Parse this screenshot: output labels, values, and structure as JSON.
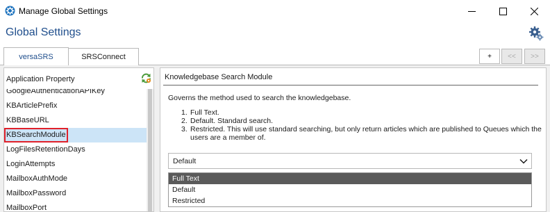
{
  "window": {
    "title": "Manage Global Settings",
    "icon": "app-gear-icon",
    "controls": [
      "minimize-icon",
      "maximize-icon",
      "close-icon"
    ]
  },
  "header": {
    "title": "Global Settings",
    "settings_icon": "settings-gear-icon"
  },
  "tabs": [
    {
      "label": "versaSRS",
      "active": true
    },
    {
      "label": "SRSConnect",
      "active": false
    }
  ],
  "nav": {
    "add_label": "+",
    "prev_label": "<<",
    "next_label": ">>"
  },
  "left_panel": {
    "header_label": "Application Property",
    "refresh_icon": "refresh-icon",
    "items": [
      {
        "label": "GoogleAuthenticationAPIKey",
        "selected": false
      },
      {
        "label": "KBArticlePrefix",
        "selected": false
      },
      {
        "label": "KBBaseURL",
        "selected": false
      },
      {
        "label": "KBSearchModule",
        "selected": true
      },
      {
        "label": "LogFilesRetentionDays",
        "selected": false
      },
      {
        "label": "LoginAttempts",
        "selected": false
      },
      {
        "label": "MailboxAuthMode",
        "selected": false
      },
      {
        "label": "MailboxPassword",
        "selected": false
      },
      {
        "label": "MailboxPort",
        "selected": false
      }
    ]
  },
  "detail": {
    "title": "Knowledgebase Search Module",
    "description": "Governs the method used to search the knowledgebase.",
    "options": [
      {
        "num": "1.",
        "text": "Full Text."
      },
      {
        "num": "2.",
        "text": "Default. Standard search."
      },
      {
        "num": "3.",
        "text": "Restricted. This will use standard searching, but only return articles which are published to Queues which the users are a member of."
      }
    ],
    "select_value": "Default",
    "dropdown_options": [
      {
        "label": "Full Text",
        "highlighted": true
      },
      {
        "label": "Default",
        "highlighted": false
      },
      {
        "label": "Restricted",
        "highlighted": false
      }
    ]
  },
  "colors": {
    "accent": "#1f4e8c",
    "selection": "#cce4f7",
    "highlight_border": "#e0202a",
    "dropdown_active": "#5a5a5a"
  }
}
